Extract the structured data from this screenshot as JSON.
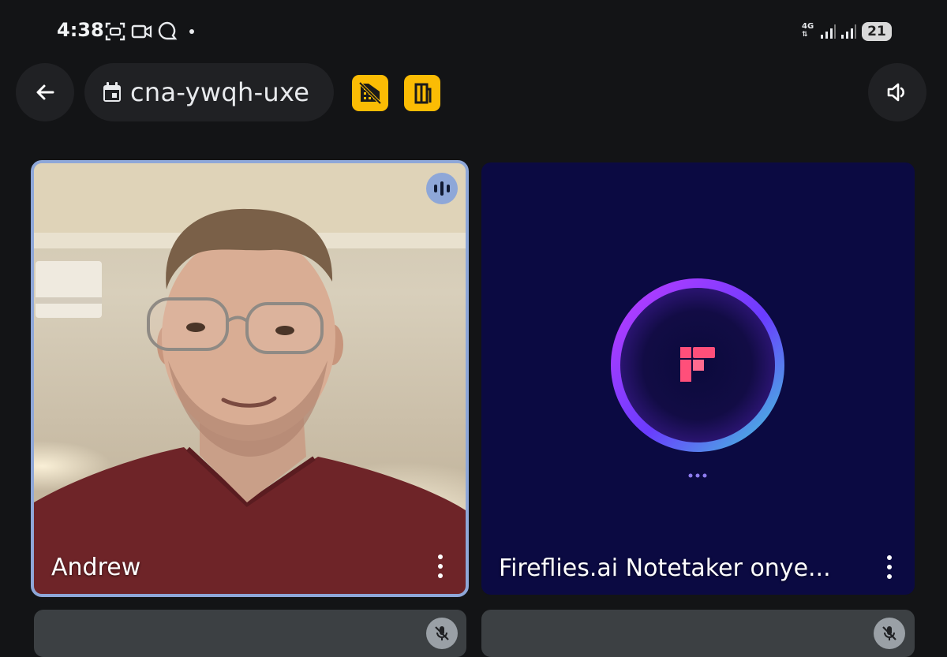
{
  "status_bar": {
    "time": "4:38",
    "network": "4G",
    "battery": "21",
    "icons": [
      "screenshot-icon",
      "video-icon",
      "chat-bubble-icon",
      "notification-dot"
    ]
  },
  "top_bar": {
    "meeting_code": "cna-ywqh-uxe",
    "icons": [
      "back-arrow-icon",
      "calendar-icon",
      "host-controls-icon",
      "room-icon",
      "speaker-icon"
    ],
    "badge_color": "#fbbc04"
  },
  "tiles": [
    {
      "name": "Andrew",
      "speaking": true,
      "accent": "#8ea7d8"
    },
    {
      "name": "Fireflies.ai Notetaker onye...",
      "speaking": false,
      "logo": "fireflies-logo"
    }
  ],
  "lower_tiles": [
    {
      "muted": true
    },
    {
      "muted": true
    }
  ]
}
